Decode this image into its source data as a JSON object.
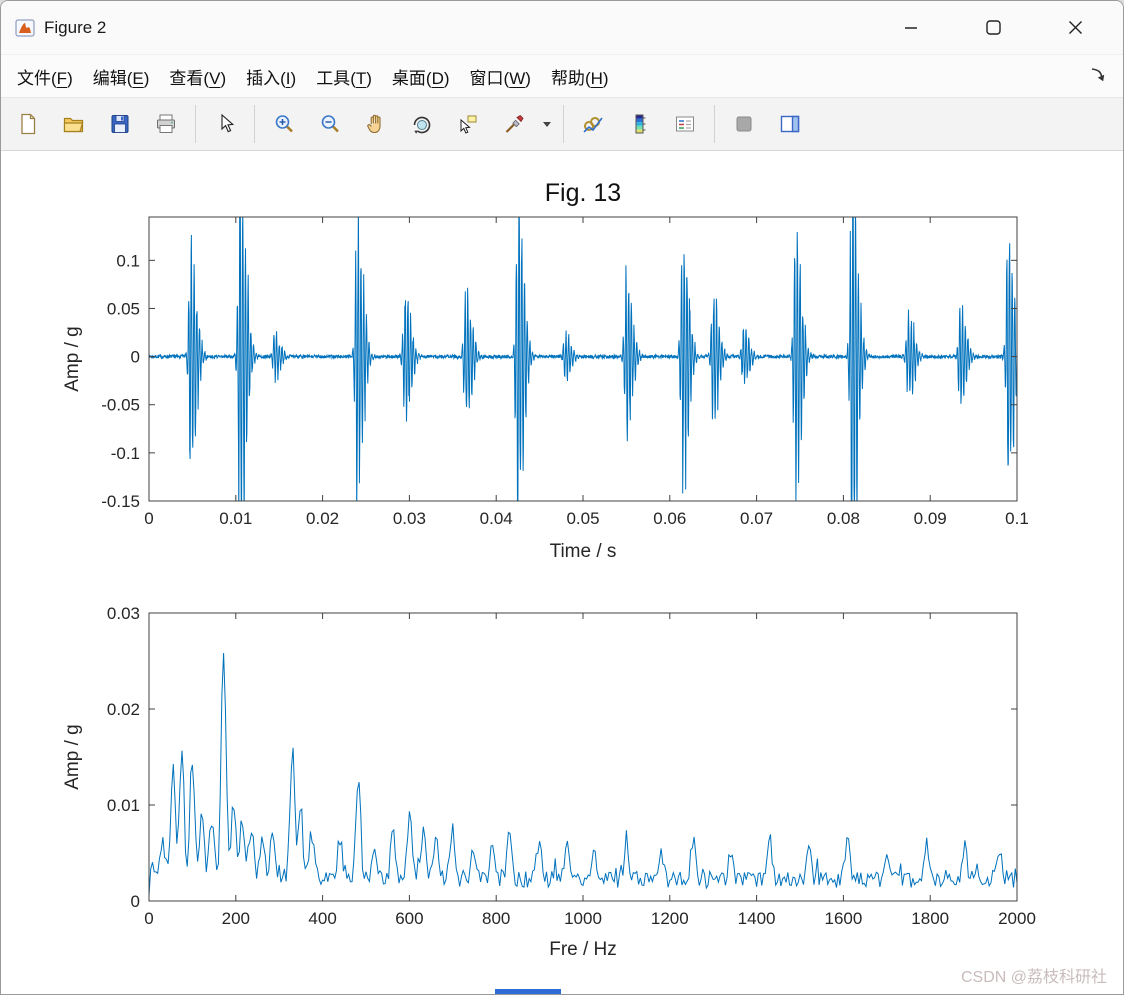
{
  "window": {
    "title": "Figure 2",
    "controls": [
      "minimize",
      "maximize",
      "close"
    ]
  },
  "menu": {
    "items": [
      {
        "id": "file",
        "label": "文件",
        "mnemonic": "F"
      },
      {
        "id": "edit",
        "label": "编辑",
        "mnemonic": "E"
      },
      {
        "id": "view",
        "label": "查看",
        "mnemonic": "V"
      },
      {
        "id": "insert",
        "label": "插入",
        "mnemonic": "I"
      },
      {
        "id": "tools",
        "label": "工具",
        "mnemonic": "T"
      },
      {
        "id": "desktop",
        "label": "桌面",
        "mnemonic": "D"
      },
      {
        "id": "window",
        "label": "窗口",
        "mnemonic": "W"
      },
      {
        "id": "help",
        "label": "帮助",
        "mnemonic": "H"
      }
    ]
  },
  "toolbar": {
    "icons": [
      "new-figure",
      "open-file",
      "save-figure",
      "print-figure",
      "edit-plot",
      "zoom-in",
      "zoom-out",
      "pan",
      "rotate-3d",
      "data-cursor",
      "brush-data",
      "brush-dropdown",
      "link-plot",
      "insert-colorbar",
      "insert-legend",
      "hide-plot-tools",
      "show-plot-tools-dock"
    ]
  },
  "accent": {
    "line_color": "#0072BD",
    "axis_color": "#404040"
  },
  "chart_data": [
    {
      "type": "line",
      "title": "Fig. 13",
      "xlabel": "Time / s",
      "ylabel": "Amp / g",
      "xlim": [
        0,
        0.1
      ],
      "ylim": [
        -0.15,
        0.145
      ],
      "xticks": [
        0,
        0.01,
        0.02,
        0.03,
        0.04,
        0.05,
        0.06,
        0.07,
        0.08,
        0.09,
        0.1
      ],
      "xtick_labels": [
        "0",
        "0.01",
        "0.02",
        "0.03",
        "0.04",
        "0.05",
        "0.06",
        "0.07",
        "0.08",
        "0.09",
        "0.1"
      ],
      "yticks": [
        -0.15,
        -0.1,
        -0.05,
        0,
        0.05,
        0.1
      ],
      "ytick_labels": [
        "-0.15",
        "-0.1",
        "-0.05",
        "0",
        "0.05",
        "0.1"
      ],
      "series_desc": "impulsive vibration time waveform with periodic bursts",
      "impulses_t_amp": [
        [
          0.0048,
          0.11
        ],
        [
          0.0105,
          0.19
        ],
        [
          0.0145,
          0.022
        ],
        [
          0.024,
          0.145
        ],
        [
          0.0295,
          0.068
        ],
        [
          0.0365,
          0.072
        ],
        [
          0.0425,
          0.175
        ],
        [
          0.048,
          0.022
        ],
        [
          0.055,
          0.082
        ],
        [
          0.0615,
          0.13
        ],
        [
          0.065,
          0.062
        ],
        [
          0.0685,
          0.03
        ],
        [
          0.0745,
          0.135
        ],
        [
          0.081,
          0.19
        ],
        [
          0.0875,
          0.045
        ],
        [
          0.0935,
          0.052
        ],
        [
          0.099,
          0.135
        ]
      ],
      "noise_amp": 0.0018,
      "carrier_hz": 3200,
      "attack_sigma_s": 0.0003,
      "decay_sigma_s": 0.0009,
      "samples": 2600,
      "seed": 7
    },
    {
      "type": "line",
      "title": "",
      "xlabel": "Fre / Hz",
      "ylabel": "Amp / g",
      "xlim": [
        0,
        2000
      ],
      "ylim": [
        0,
        0.03
      ],
      "xticks": [
        0,
        200,
        400,
        600,
        800,
        1000,
        1200,
        1400,
        1600,
        1800,
        2000
      ],
      "xtick_labels": [
        "0",
        "200",
        "400",
        "600",
        "800",
        "1000",
        "1200",
        "1400",
        "1600",
        "1800",
        "2000"
      ],
      "yticks": [
        0,
        0.01,
        0.02,
        0.03
      ],
      "ytick_labels": [
        "0",
        "0.01",
        "0.02",
        "0.03"
      ],
      "series_desc": "amplitude spectrum, dominant peak near 170 Hz",
      "peaks_hz_amp": [
        [
          30,
          0.003
        ],
        [
          55,
          0.011
        ],
        [
          75,
          0.0132
        ],
        [
          100,
          0.0126
        ],
        [
          122,
          0.0062
        ],
        [
          145,
          0.006
        ],
        [
          172,
          0.0258
        ],
        [
          195,
          0.0082
        ],
        [
          215,
          0.0066
        ],
        [
          235,
          0.0056
        ],
        [
          262,
          0.0042
        ],
        [
          285,
          0.0046
        ],
        [
          330,
          0.0142
        ],
        [
          348,
          0.0082
        ],
        [
          375,
          0.0044
        ],
        [
          440,
          0.0038
        ],
        [
          482,
          0.0108
        ],
        [
          520,
          0.0042
        ],
        [
          562,
          0.0052
        ],
        [
          600,
          0.0066
        ],
        [
          632,
          0.0056
        ],
        [
          660,
          0.0044
        ],
        [
          700,
          0.0048
        ],
        [
          748,
          0.0034
        ],
        [
          792,
          0.0038
        ],
        [
          830,
          0.0048
        ],
        [
          900,
          0.0034
        ],
        [
          962,
          0.0038
        ],
        [
          1025,
          0.0032
        ],
        [
          1100,
          0.0038
        ],
        [
          1180,
          0.0032
        ],
        [
          1255,
          0.0036
        ],
        [
          1340,
          0.0032
        ],
        [
          1430,
          0.0038
        ],
        [
          1520,
          0.0034
        ],
        [
          1610,
          0.004
        ],
        [
          1700,
          0.0036
        ],
        [
          1790,
          0.0034
        ],
        [
          1880,
          0.0038
        ],
        [
          1960,
          0.0034
        ]
      ],
      "peak_sigma_hz": 7,
      "freq_step_hz": 4,
      "floor_base": 0.0013,
      "floor_jitter": 0.0017,
      "spike_prob": 0.1,
      "spike_amp": 0.0016,
      "lowfreq_boost": 0.001,
      "lowfreq_decay_hz": 420,
      "seed": 11
    }
  ],
  "watermark": {
    "text": "CSDN @荔枝科研社"
  }
}
